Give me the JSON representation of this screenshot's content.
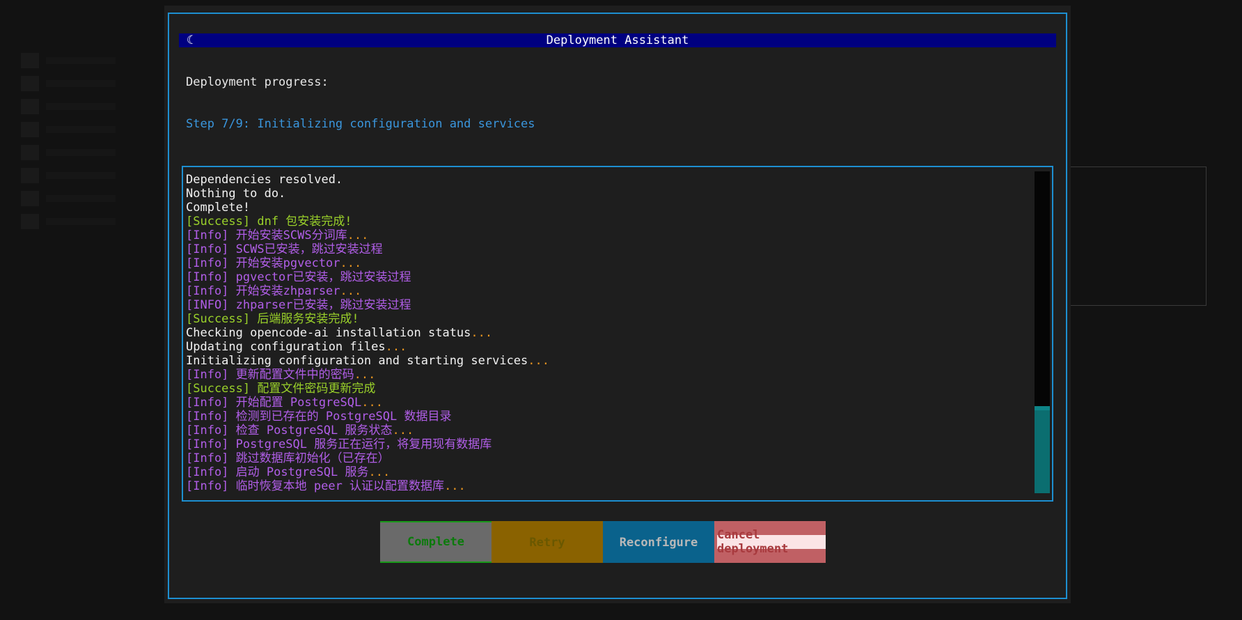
{
  "dialog": {
    "title": "Deployment Assistant",
    "spinner_glyph": "☾",
    "heading": "Deployment progress:",
    "step": "Step 7/9: Initializing configuration and services"
  },
  "log": {
    "lines": [
      [
        {
          "t": "Dependencies resolved.",
          "c": "white"
        }
      ],
      [
        {
          "t": "Nothing to do.",
          "c": "white"
        }
      ],
      [
        {
          "t": "Complete!",
          "c": "white"
        }
      ],
      [
        {
          "t": "[Success] dnf 包安装完成!",
          "c": "green"
        }
      ],
      [
        {
          "t": "[Info] 开始安装SCWS分词库",
          "c": "purple"
        },
        {
          "t": "...",
          "c": "orange"
        }
      ],
      [
        {
          "t": "[Info] SCWS已安装，跳过安装过程",
          "c": "purple"
        }
      ],
      [
        {
          "t": "[Info] 开始安装pgvector",
          "c": "purple"
        },
        {
          "t": "...",
          "c": "orange"
        }
      ],
      [
        {
          "t": "[Info] pgvector已安装，跳过安装过程",
          "c": "purple"
        }
      ],
      [
        {
          "t": "[Info] 开始安装zhparser",
          "c": "purple"
        },
        {
          "t": "...",
          "c": "orange"
        }
      ],
      [
        {
          "t": "[INFO] zhparser已安装，跳过安装过程",
          "c": "purple"
        }
      ],
      [
        {
          "t": "[Success] 后端服务安装完成!",
          "c": "green"
        }
      ],
      [
        {
          "t": "Checking opencode-ai installation status",
          "c": "white"
        },
        {
          "t": "...",
          "c": "orange"
        }
      ],
      [
        {
          "t": "Updating configuration files",
          "c": "white"
        },
        {
          "t": "...",
          "c": "orange"
        }
      ],
      [
        {
          "t": "Initializing configuration and starting services",
          "c": "white"
        },
        {
          "t": "...",
          "c": "orange"
        }
      ],
      [
        {
          "t": "[Info] 更新配置文件中的密码",
          "c": "purple"
        },
        {
          "t": "...",
          "c": "orange"
        }
      ],
      [
        {
          "t": "[Success] 配置文件密码更新完成",
          "c": "green"
        }
      ],
      [
        {
          "t": "[Info] 开始配置 PostgreSQL",
          "c": "purple"
        },
        {
          "t": "...",
          "c": "orange"
        }
      ],
      [
        {
          "t": "[Info] 检测到已存在的 PostgreSQL 数据目录",
          "c": "purple"
        }
      ],
      [
        {
          "t": "[Info] 检查 PostgreSQL 服务状态",
          "c": "purple"
        },
        {
          "t": "...",
          "c": "orange"
        }
      ],
      [
        {
          "t": "[Info] PostgreSQL 服务正在运行，将复用现有数据库",
          "c": "purple"
        }
      ],
      [
        {
          "t": "[Info] 跳过数据库初始化（已存在）",
          "c": "purple"
        }
      ],
      [
        {
          "t": "[Info] 启动 PostgreSQL 服务",
          "c": "purple"
        },
        {
          "t": "...",
          "c": "orange"
        }
      ],
      [
        {
          "t": "[Info] 临时恢复本地 peer 认证以配置数据库",
          "c": "purple"
        },
        {
          "t": "...",
          "c": "orange"
        }
      ]
    ],
    "scroll_position": 0.82,
    "scroll_visible_fraction": 0.27
  },
  "buttons": {
    "complete": "Complete",
    "retry": "Retry",
    "reconfigure": "Reconfigure",
    "cancel": "Cancel deployment"
  },
  "colors": {
    "frame": "#1d8fd1",
    "title_bg": "#000080",
    "step": "#3a96dd",
    "success": "#9ad12a",
    "info": "#b15ee8",
    "ellipsis": "#e89520"
  }
}
